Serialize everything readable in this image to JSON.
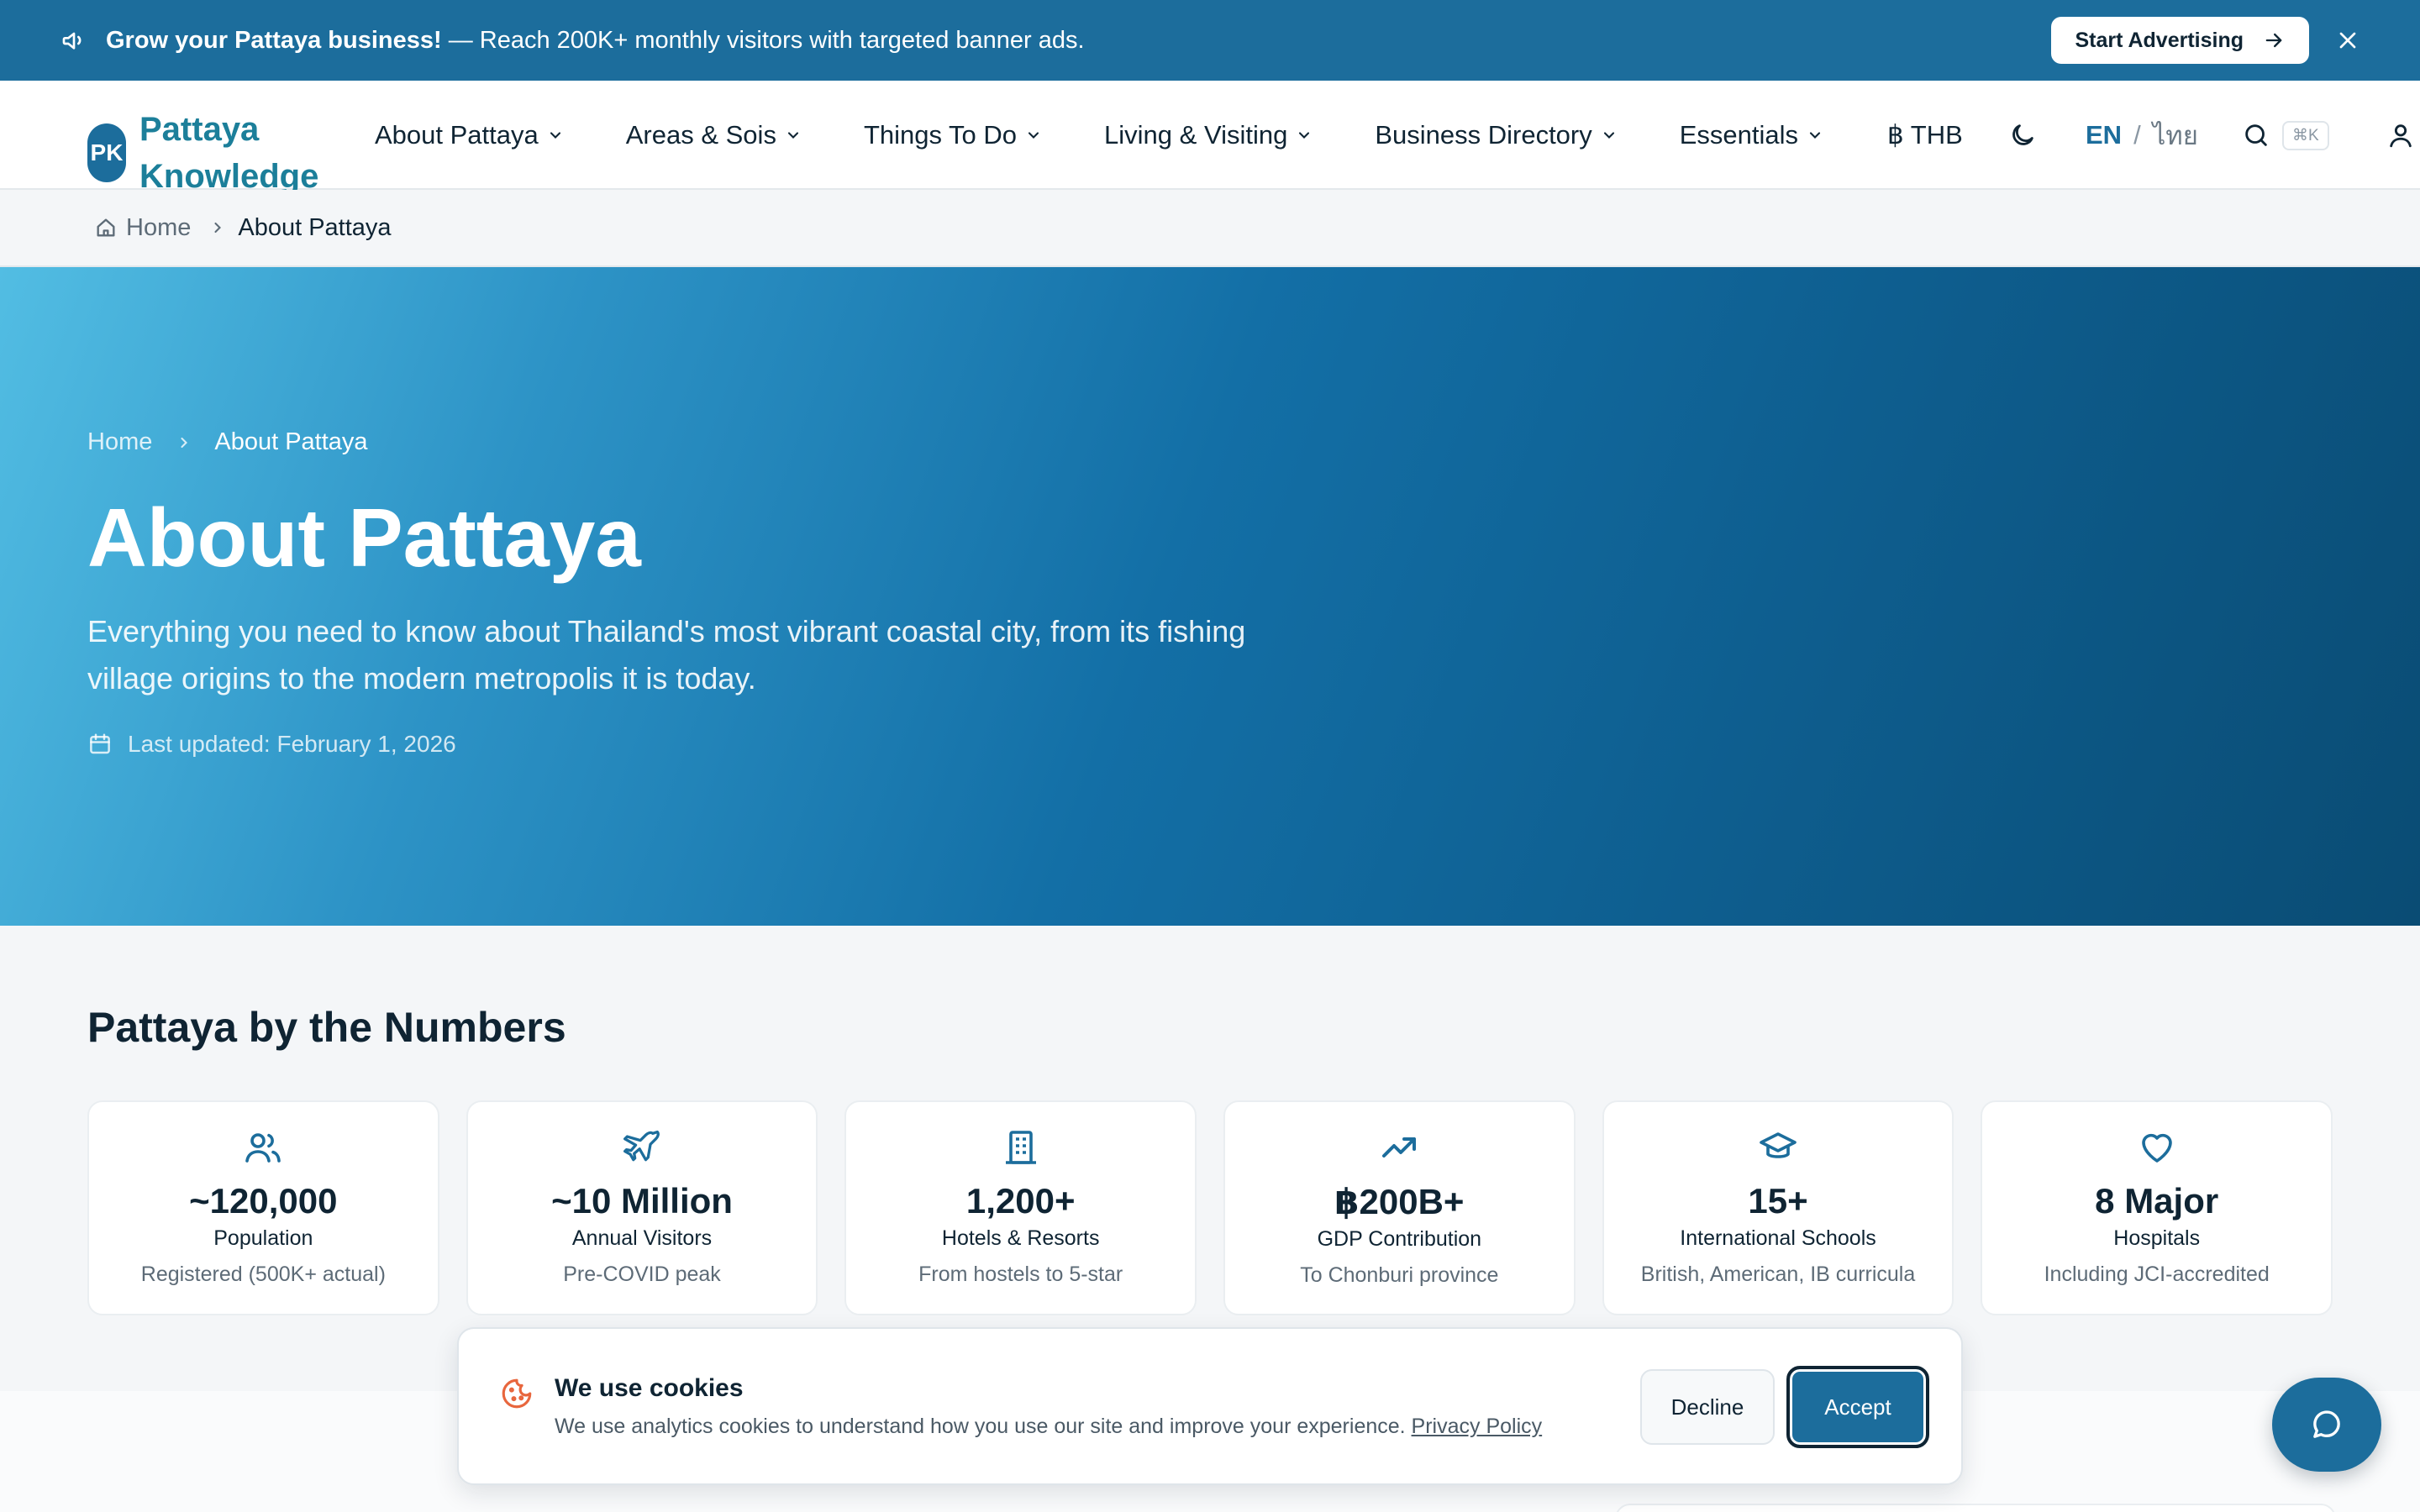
{
  "promo": {
    "headline": "Grow your Pattaya business!",
    "message": " — Reach 200K+ monthly visitors with targeted banner ads.",
    "cta_label": "Start Advertising"
  },
  "header": {
    "logo_mark": "PK",
    "logo_name": "Pattaya Knowledge",
    "nav": [
      {
        "label": "About Pattaya"
      },
      {
        "label": "Areas & Sois"
      },
      {
        "label": "Things To Do"
      },
      {
        "label": "Living & Visiting"
      },
      {
        "label": "Business Directory"
      },
      {
        "label": "Essentials"
      }
    ],
    "currency": "฿ THB",
    "lang_active": "EN",
    "lang_sep": "/",
    "lang_other": "ไทย",
    "search_shortcut": "⌘K"
  },
  "breadcrumb": {
    "home": "Home",
    "current": "About Pattaya"
  },
  "hero": {
    "crumb_home": "Home",
    "crumb_current": "About Pattaya",
    "title": "About Pattaya",
    "lead": "Everything you need to know about Thailand's most vibrant coastal city, from its fishing village origins to the modern metropolis it is today.",
    "updated": "Last updated: February 1, 2026"
  },
  "stats": {
    "title": "Pattaya by the Numbers",
    "items": [
      {
        "icon": "users-icon",
        "value": "~120,000",
        "label": "Population",
        "sub": "Registered (500K+ actual)"
      },
      {
        "icon": "plane-icon",
        "value": "~10 Million",
        "label": "Annual Visitors",
        "sub": "Pre-COVID peak"
      },
      {
        "icon": "building-icon",
        "value": "1,200+",
        "label": "Hotels & Resorts",
        "sub": "From hostels to 5-star"
      },
      {
        "icon": "trending-up-icon",
        "value": "฿200B+",
        "label": "GDP Contribution",
        "sub": "To Chonburi province"
      },
      {
        "icon": "graduation-cap-icon",
        "value": "15+",
        "label": "International Schools",
        "sub": "British, American, IB curricula"
      },
      {
        "icon": "heart-icon",
        "value": "8 Major",
        "label": "Hospitals",
        "sub": "Including JCI-accredited"
      }
    ]
  },
  "cookie": {
    "title": "We use cookies",
    "text": "We use analytics cookies to understand how you use our site and improve your experience. ",
    "link": "Privacy Policy",
    "decline": "Decline",
    "accept": "Accept"
  },
  "colors": {
    "brand": "#1c6d9c",
    "accent_teal": "#1c7f9a",
    "text": "#0f2433",
    "cookie_icon": "#e8663d"
  }
}
